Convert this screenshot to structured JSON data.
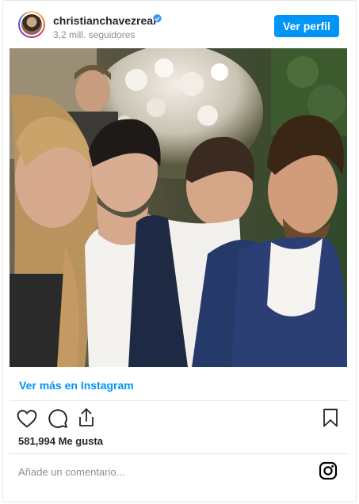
{
  "header": {
    "username": "christianchavezreal",
    "followers": "3,2 mill. seguidores",
    "profile_button": "Ver perfil"
  },
  "post": {
    "view_more_link": "Ver más en Instagram",
    "likes": "581,994 Me gusta",
    "comment_placeholder": "Añade un comentario..."
  },
  "icons": {
    "verified": "verified-badge-icon",
    "like": "heart-icon",
    "comment": "comment-bubble-icon",
    "share": "share-icon",
    "save": "bookmark-icon",
    "brand": "instagram-icon"
  },
  "colors": {
    "accent": "#0095f6",
    "text": "#262626",
    "muted": "#8e8e8e",
    "border": "#e6e6e6"
  }
}
